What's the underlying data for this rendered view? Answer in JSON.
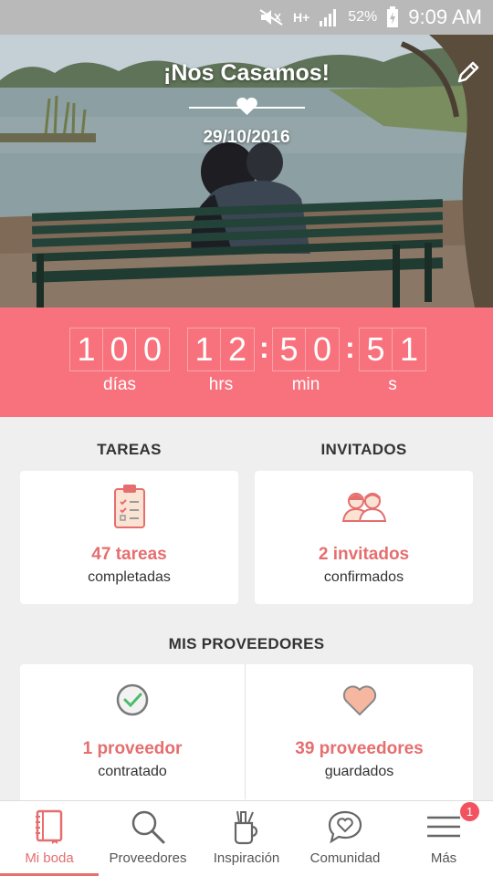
{
  "status_bar": {
    "network": "H+",
    "battery_pct": "52%",
    "time": "9:09 AM"
  },
  "hero": {
    "title": "¡Nos Casamos!",
    "date": "29/10/2016"
  },
  "countdown": {
    "days": [
      "1",
      "0",
      "0"
    ],
    "hours": [
      "1",
      "2"
    ],
    "minutes": [
      "5",
      "0"
    ],
    "seconds": [
      "5",
      "1"
    ],
    "labels": {
      "days": "días",
      "hours": "hrs",
      "minutes": "min",
      "seconds": "s"
    }
  },
  "tasks": {
    "title": "TAREAS",
    "value": "47 tareas",
    "sub": "completadas"
  },
  "guests": {
    "title": "INVITADOS",
    "value": "2 invitados",
    "sub": "confirmados"
  },
  "providers": {
    "title": "MIS PROVEEDORES",
    "hired": {
      "value": "1 proveedor",
      "sub": "contratado"
    },
    "saved": {
      "value": "39 proveedores",
      "sub": "guardados"
    }
  },
  "nav": {
    "items": [
      {
        "label": "Mi boda",
        "icon": "notebook-icon"
      },
      {
        "label": "Proveedores",
        "icon": "search-icon"
      },
      {
        "label": "Inspiración",
        "icon": "inspiration-icon"
      },
      {
        "label": "Comunidad",
        "icon": "chat-heart-icon"
      },
      {
        "label": "Más",
        "icon": "menu-icon"
      }
    ],
    "badge": "1"
  },
  "colors": {
    "accent": "#f7727c",
    "accent_text": "#e56e6f",
    "background": "#efefef"
  }
}
